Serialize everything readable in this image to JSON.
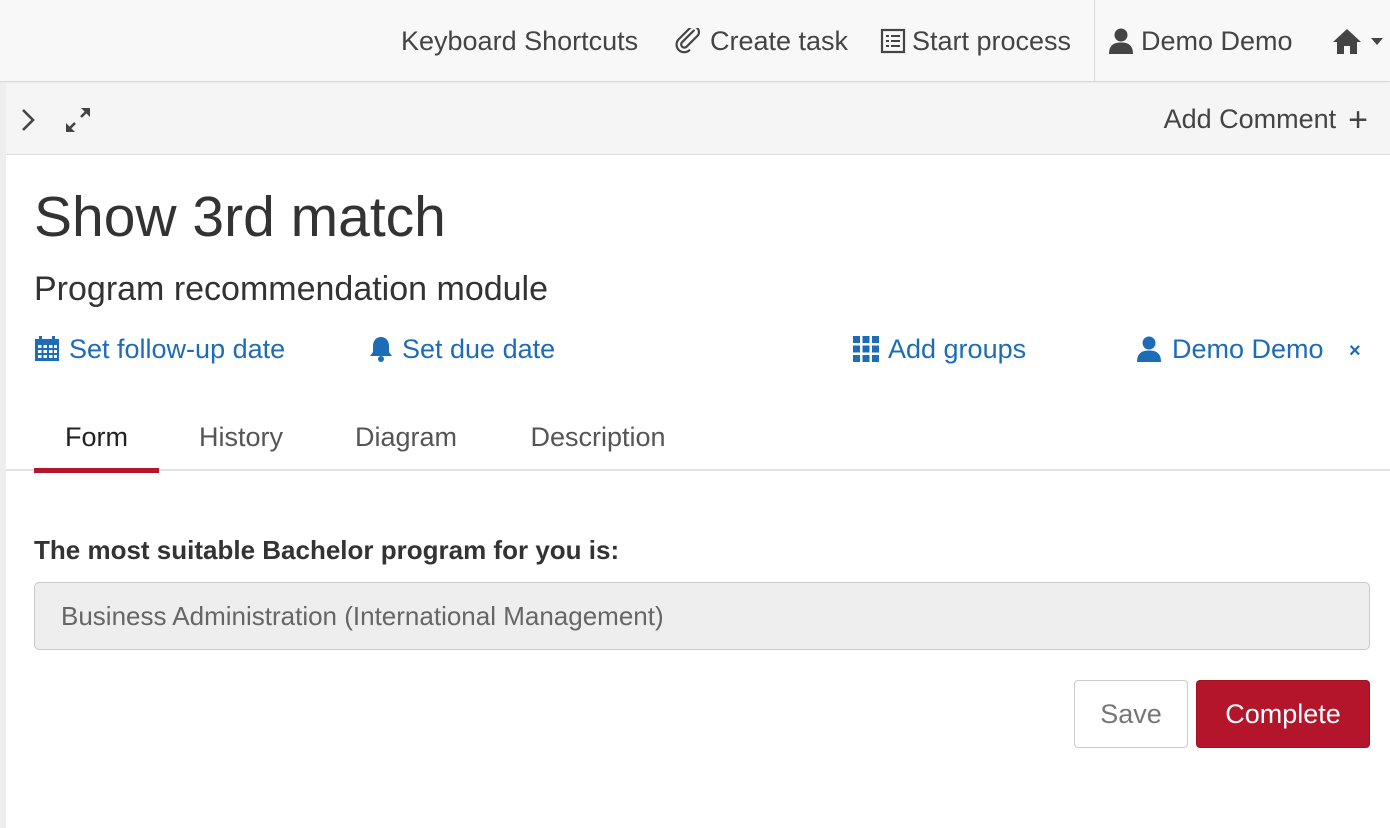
{
  "topnav": {
    "keyboard_shortcuts": "Keyboard Shortcuts",
    "create_task": "Create task",
    "start_process": "Start process",
    "user_name": "Demo Demo"
  },
  "toolbar": {
    "add_comment": "Add Comment",
    "add_comment_plus": "+"
  },
  "task": {
    "title": "Show 3rd match",
    "subtitle": "Program recommendation module",
    "follow_up": "Set follow-up date",
    "due_date": "Set due date",
    "add_groups": "Add groups",
    "assignee": "Demo Demo",
    "remove_assignee": "×"
  },
  "tabs": {
    "form": "Form",
    "history": "History",
    "diagram": "Diagram",
    "description": "Description",
    "active": "Form"
  },
  "form": {
    "label": "The most suitable Bachelor program for you is:",
    "value": "Business Administration (International Management)",
    "save": "Save",
    "complete": "Complete"
  },
  "colors": {
    "accent": "#b5152b",
    "link": "#1c6cb8"
  },
  "icons": {
    "create_task": "paperclip-icon",
    "start_process": "list-icon",
    "user": "user-icon",
    "home": "home-icon",
    "home_caret": "caret-down-icon",
    "expand_sidebar": "chevron-right-icon",
    "maximize": "expand-icon",
    "follow_up": "calendar-icon",
    "due_date": "bell-icon",
    "groups": "grid-icon",
    "assignee": "user-icon"
  }
}
